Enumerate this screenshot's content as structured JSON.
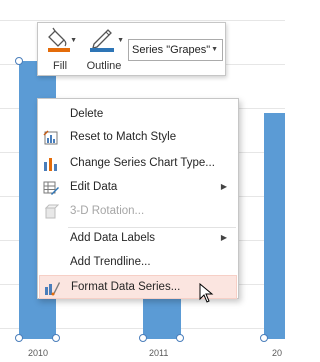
{
  "chart": {
    "axis_labels": [
      "2010",
      "2011",
      "20"
    ]
  },
  "mini_toolbar": {
    "fill_label": "Fill",
    "outline_label": "Outline",
    "series_selector_value": "Series \"Grapes\""
  },
  "context_menu": {
    "items": [
      {
        "label": "Delete",
        "icon": "delete-icon"
      },
      {
        "label": "Reset to Match Style",
        "icon": "reset-style-icon"
      },
      {
        "label": "Change Series Chart Type...",
        "icon": "chart-type-icon"
      },
      {
        "label": "Edit Data",
        "icon": "edit-data-icon",
        "submenu": true
      },
      {
        "label": "3-D Rotation...",
        "icon": "rotation-icon",
        "disabled": true
      },
      {
        "label": "Add Data Labels",
        "submenu": true
      },
      {
        "label": "Add Trendline..."
      },
      {
        "label": "Format Data Series...",
        "icon": "format-series-icon",
        "highlighted": true
      }
    ]
  },
  "colors": {
    "bar": "#5b9bd5",
    "menu_highlight": "#fbe5e0",
    "fill_accent": "#e46c0a",
    "outline_accent": "#2e75b6"
  }
}
